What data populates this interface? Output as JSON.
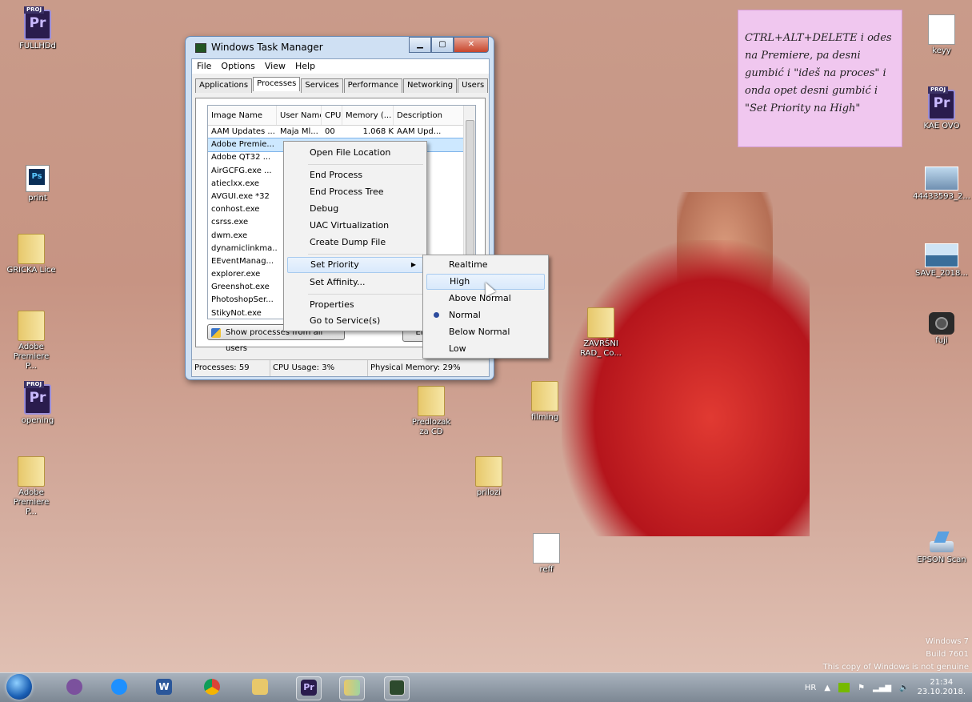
{
  "desktop_icons": [
    {
      "label": "FULLHDd",
      "type": "premiere",
      "badge": "PROJ",
      "glyph": "Pr"
    },
    {
      "label": "print",
      "type": "photoshop",
      "glyph": "Ps"
    },
    {
      "label": "GRICKA Lice",
      "type": "folder"
    },
    {
      "label": "Adobe Premiere P...",
      "type": "folder"
    },
    {
      "label": "opening",
      "type": "premiere",
      "badge": "PROJ",
      "glyph": "Pr"
    },
    {
      "label": "Adobe Premiere P...",
      "type": "folder"
    },
    {
      "label": "Predlozak za CD",
      "type": "folder"
    },
    {
      "label": "filming",
      "type": "folder"
    },
    {
      "label": "prilozi",
      "type": "folder"
    },
    {
      "label": "reff",
      "type": "document"
    },
    {
      "label": "ZAVRŠNI RAD_ Co...",
      "type": "folder"
    },
    {
      "label": "keyy",
      "type": "document"
    },
    {
      "label": "KAE OVO",
      "type": "premiere",
      "badge": "PROJ",
      "glyph": "Pr"
    },
    {
      "label": "44433593_2...",
      "type": "image"
    },
    {
      "label": "SAVE_2018...",
      "type": "image"
    },
    {
      "label": "fuji",
      "type": "camera"
    },
    {
      "label": "EPSON Scan",
      "type": "scanner"
    }
  ],
  "sticky_note": {
    "text": "CTRL+ALT+DELETE i odes\nna Premiere, pa desni\ngumbić i \"ideš na proces\" i\nonda opet desni gumbić i\n\"Set Priority na High\""
  },
  "task_manager": {
    "title": "Windows Task Manager",
    "menu": [
      "File",
      "Options",
      "View",
      "Help"
    ],
    "tabs": [
      "Applications",
      "Processes",
      "Services",
      "Performance",
      "Networking",
      "Users"
    ],
    "active_tab": "Processes",
    "columns": [
      "Image Name",
      "User Name",
      "CPU",
      "Memory (...",
      "Description"
    ],
    "rows": [
      [
        "AAM Updates ...",
        "Maja Ml...",
        "00",
        "1.068 K",
        "AAM Upd..."
      ],
      [
        "Adobe Premie...",
        "",
        "",
        "",
        "e Pr..."
      ],
      [
        "Adobe QT32 ...",
        "",
        "",
        "",
        "e QT..."
      ],
      [
        "AirGCFG.exe ...",
        "",
        "",
        "",
        "k WL..."
      ],
      [
        "atieclxx.exe",
        "",
        "",
        "",
        ""
      ],
      [
        "AVGUI.exe *32",
        "",
        "",
        "",
        "Antiv..."
      ],
      [
        "conhost.exe",
        "",
        "",
        "",
        "ole ..."
      ],
      [
        "csrss.exe",
        "",
        "",
        "",
        ""
      ],
      [
        "dwm.exe",
        "",
        "",
        "",
        "top ..."
      ],
      [
        "dynamiclinkma...",
        "",
        "",
        "",
        "micli..."
      ],
      [
        "EEventManag...",
        "",
        "",
        "",
        ""
      ],
      [
        "explorer.exe",
        "",
        "",
        "",
        ""
      ],
      [
        "Greenshot.exe",
        "",
        "",
        "",
        ""
      ],
      [
        "PhotoshopSer...",
        "",
        "",
        "",
        ""
      ],
      [
        "StikyNot.exe",
        "",
        "",
        "",
        ""
      ]
    ],
    "show_all_button": "Show processes from all users",
    "end_button": "Ei",
    "status": {
      "processes": "Processes: 59",
      "cpu": "CPU Usage: 3%",
      "memory": "Physical Memory: 29%"
    }
  },
  "context_menu": {
    "items": [
      "Open File Location",
      "End Process",
      "End Process Tree",
      "Debug",
      "UAC Virtualization",
      "Create Dump File",
      "Set Priority",
      "Set Affinity...",
      "Properties",
      "Go to Service(s)"
    ],
    "highlighted": "Set Priority"
  },
  "priority_submenu": {
    "items": [
      "Realtime",
      "High",
      "Above Normal",
      "Normal",
      "Below Normal",
      "Low"
    ],
    "highlighted": "High",
    "checked": "Normal"
  },
  "watermark": {
    "line1": "Windows 7",
    "line2": "Build 7601",
    "line3": "This copy of Windows is not genuine"
  },
  "taskbar": {
    "apps": [
      "viber",
      "messenger",
      "word",
      "chrome",
      "explorer",
      "premiere",
      "windows-explorer",
      "task-manager"
    ],
    "tray": {
      "lang": "HR",
      "time": "21:34",
      "date": "23.10.2018."
    }
  }
}
